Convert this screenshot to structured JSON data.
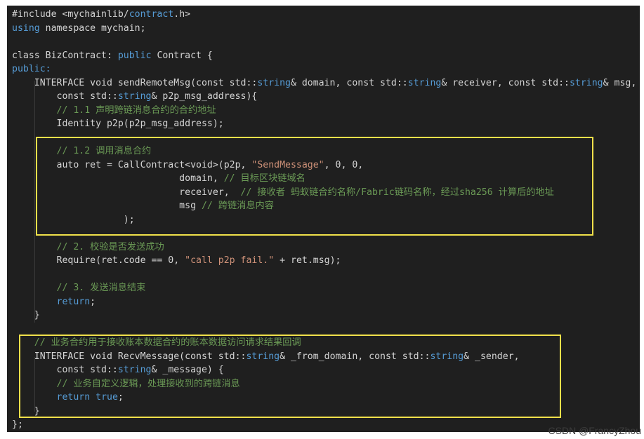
{
  "editor": {
    "lines": [
      [
        {
          "t": "#include <mychainlib/",
          "c": "df"
        },
        {
          "t": "contract",
          "c": "kw"
        },
        {
          "t": ".h>",
          "c": "df"
        }
      ],
      [
        {
          "t": "using",
          "c": "kw"
        },
        {
          "t": " namespace mychain;",
          "c": "df"
        }
      ],
      [
        {
          "t": "",
          "c": "df"
        }
      ],
      [
        {
          "t": "class BizContract: ",
          "c": "df"
        },
        {
          "t": "public",
          "c": "kw"
        },
        {
          "t": " Contract {",
          "c": "df"
        }
      ],
      [
        {
          "t": "public:",
          "c": "kw"
        }
      ],
      [
        {
          "t": "    INTERFACE void sendRemoteMsg(const std::",
          "c": "df"
        },
        {
          "t": "string",
          "c": "kw"
        },
        {
          "t": "& domain, const std::",
          "c": "df"
        },
        {
          "t": "string",
          "c": "kw"
        },
        {
          "t": "& receiver, const std::",
          "c": "df"
        },
        {
          "t": "string",
          "c": "kw"
        },
        {
          "t": "& msg,",
          "c": "df"
        }
      ],
      [
        {
          "t": "        const std::",
          "c": "df"
        },
        {
          "t": "string",
          "c": "kw"
        },
        {
          "t": "& p2p_msg_address){",
          "c": "df"
        }
      ],
      [
        {
          "t": "        // 1.1 声明跨链消息合约的合约地址",
          "c": "cm"
        }
      ],
      [
        {
          "t": "        Identity p2p(p2p_msg_address);",
          "c": "df"
        }
      ],
      [
        {
          "t": "",
          "c": "df"
        }
      ],
      [
        {
          "t": "        // 1.2 调用消息合约",
          "c": "cm"
        }
      ],
      [
        {
          "t": "        auto ret = CallContract<void>(p2p, ",
          "c": "df"
        },
        {
          "t": "\"SendMessage\"",
          "c": "st"
        },
        {
          "t": ", 0, 0,",
          "c": "df"
        }
      ],
      [
        {
          "t": "                              domain, ",
          "c": "df"
        },
        {
          "t": "// 目标区块链域名",
          "c": "cm"
        }
      ],
      [
        {
          "t": "                              receiver,  ",
          "c": "df"
        },
        {
          "t": "// 接收者 蚂蚁链合约名称/Fabric链码名称，经过sha256 计算后的地址",
          "c": "cm"
        }
      ],
      [
        {
          "t": "                              msg ",
          "c": "df"
        },
        {
          "t": "// 跨链消息内容",
          "c": "cm"
        }
      ],
      [
        {
          "t": "                    );",
          "c": "df"
        }
      ],
      [
        {
          "t": "",
          "c": "df"
        }
      ],
      [
        {
          "t": "        // 2. 校验是否发送成功",
          "c": "cm"
        }
      ],
      [
        {
          "t": "        Require(ret.code == 0, ",
          "c": "df"
        },
        {
          "t": "\"call p2p fail.\"",
          "c": "st"
        },
        {
          "t": " + ret.msg);",
          "c": "df"
        }
      ],
      [
        {
          "t": "",
          "c": "df"
        }
      ],
      [
        {
          "t": "        // 3. 发送消息结束",
          "c": "cm"
        }
      ],
      [
        {
          "t": "        ",
          "c": "df"
        },
        {
          "t": "return",
          "c": "kw"
        },
        {
          "t": ";",
          "c": "df"
        }
      ],
      [
        {
          "t": "    }",
          "c": "df"
        }
      ],
      [
        {
          "t": "",
          "c": "df"
        }
      ],
      [
        {
          "t": "    // 业务合约用于接收账本数据合约的账本数据访问请求结果回调",
          "c": "cm"
        }
      ],
      [
        {
          "t": "    INTERFACE void RecvMessage(const std::",
          "c": "df"
        },
        {
          "t": "string",
          "c": "kw"
        },
        {
          "t": "& _from_domain, const std::",
          "c": "df"
        },
        {
          "t": "string",
          "c": "kw"
        },
        {
          "t": "& _sender,",
          "c": "df"
        }
      ],
      [
        {
          "t": "        const std::",
          "c": "df"
        },
        {
          "t": "string",
          "c": "kw"
        },
        {
          "t": "& _message) {",
          "c": "df"
        }
      ],
      [
        {
          "t": "        // 业务自定义逻辑，处理接收到的跨链消息",
          "c": "cm"
        }
      ],
      [
        {
          "t": "        ",
          "c": "df"
        },
        {
          "t": "return",
          "c": "kw"
        },
        {
          "t": " ",
          "c": "df"
        },
        {
          "t": "true",
          "c": "kw"
        },
        {
          "t": ";",
          "c": "df"
        }
      ],
      [
        {
          "t": "    }",
          "c": "df"
        }
      ],
      [
        {
          "t": "};",
          "c": "df"
        }
      ]
    ]
  },
  "colors": {
    "background": "#1f1f1f",
    "keyword": "#569cd6",
    "comment": "#6a9955",
    "string": "#ce9178",
    "default": "#d4d4d4",
    "highlight_box": "#f0e04a"
  },
  "watermark": "CSDN @FrancyZhou"
}
